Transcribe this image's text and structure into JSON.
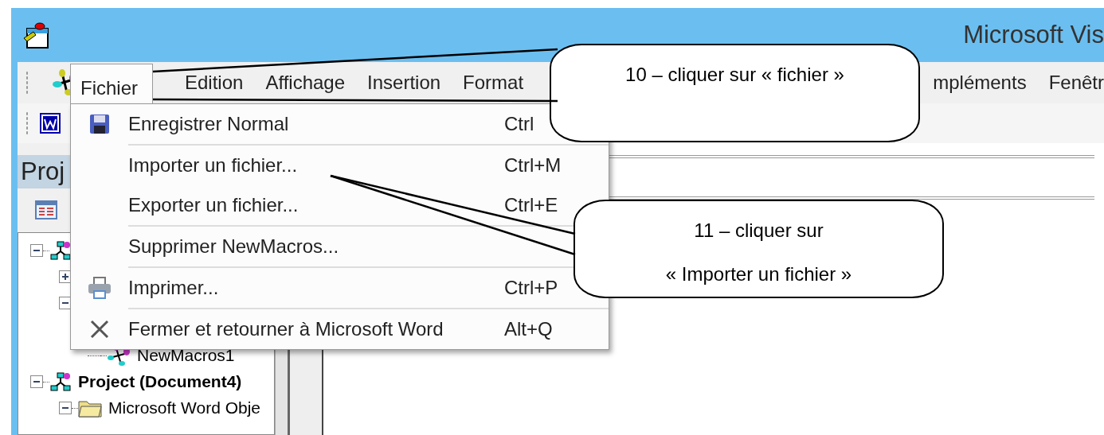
{
  "window": {
    "title": "Microsoft Vis"
  },
  "menu_bar": [
    {
      "label": "Fichier",
      "selected": true
    },
    {
      "label": "Edition",
      "selected": false
    },
    {
      "label": "Affichage",
      "selected": false
    },
    {
      "label": "Insertion",
      "selected": false
    },
    {
      "label": "Format",
      "selected": false
    },
    {
      "label": "mpléments",
      "selected": false
    },
    {
      "label": "Fenêtr",
      "selected": false
    }
  ],
  "project_panel": {
    "title": "Proj",
    "tree": [
      {
        "kind": "project",
        "expanded": true,
        "children": [
          {
            "expanded": false
          },
          {
            "expanded": true,
            "children": [
              {
                "kind": "module",
                "label": "NewMacros1"
              }
            ]
          }
        ]
      },
      {
        "kind": "project",
        "label": "Project (Document4)",
        "expanded": true,
        "children": [
          {
            "kind": "folder",
            "label": "Microsoft Word Obje",
            "expanded": true
          }
        ]
      }
    ]
  },
  "file_menu": {
    "items": [
      {
        "kind": "item",
        "label": "Enregistrer Normal",
        "shortcut": "Ctrl"
      },
      {
        "kind": "separator"
      },
      {
        "kind": "item",
        "label": "Importer un fichier...",
        "shortcut": "Ctrl+M"
      },
      {
        "kind": "item",
        "label": "Exporter un fichier...",
        "shortcut": "Ctrl+E"
      },
      {
        "kind": "separator"
      },
      {
        "kind": "item",
        "label": "Supprimer NewMacros..."
      },
      {
        "kind": "separator"
      },
      {
        "kind": "item",
        "label": "Imprimer...",
        "shortcut": "Ctrl+P"
      },
      {
        "kind": "separator"
      },
      {
        "kind": "item",
        "label": "Fermer et retourner à Microsoft Word",
        "shortcut": "Alt+Q"
      }
    ]
  },
  "callouts": [
    {
      "lines": [
        "10 – cliquer sur « fichier »"
      ]
    },
    {
      "lines": [
        "11 – cliquer sur",
        "« Importer un fichier »"
      ]
    }
  ]
}
